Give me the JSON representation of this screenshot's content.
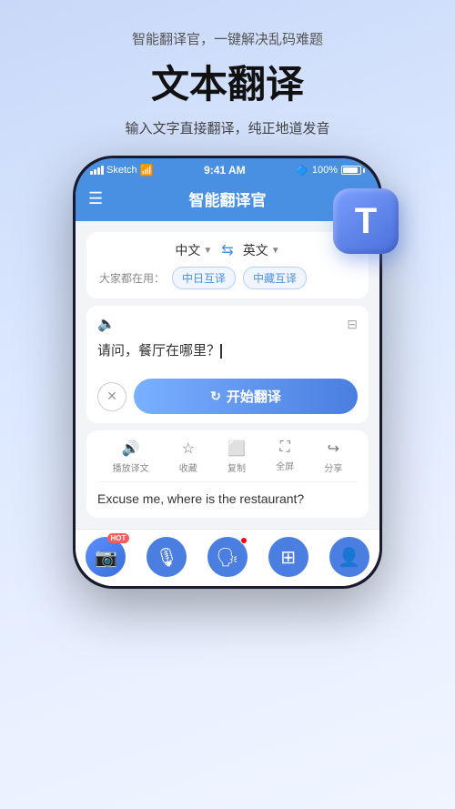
{
  "page": {
    "bg_subtitle": "智能翻译官，一键解决乱码难题",
    "bg_title": "文本翻译",
    "bg_desc": "输入文字直接翻译，纯正地道发音"
  },
  "status_bar": {
    "signal": "Sketch",
    "time": "9:41 AM",
    "battery_pct": "100%"
  },
  "header": {
    "title": "智能翻译官"
  },
  "lang_selector": {
    "source_lang": "中文",
    "source_arrow": "▼",
    "target_lang": "英文",
    "target_arrow": "▼",
    "popular_label": "大家都在用：",
    "tag1": "中日互译",
    "tag2": "中藏互译"
  },
  "input_area": {
    "text": "请问，餐厅在哪里？",
    "clear_icon": "✕",
    "translate_btn": "开始翻译"
  },
  "output_area": {
    "actions": [
      {
        "icon": "🔊",
        "label": "播放译文"
      },
      {
        "icon": "☆",
        "label": "收藏"
      },
      {
        "icon": "⬜",
        "label": "复制"
      },
      {
        "icon": "⛶",
        "label": "全屏"
      },
      {
        "icon": "↪",
        "label": "分享"
      }
    ],
    "text": "Excuse me, where is the restaurant?"
  },
  "bottom_nav": [
    {
      "icon": "📷",
      "label": "",
      "has_hot": true
    },
    {
      "icon": "🎙",
      "label": ""
    },
    {
      "icon": "👤",
      "label": "",
      "has_dot": true
    },
    {
      "icon": "⊞",
      "label": ""
    },
    {
      "icon": "👤",
      "label": ""
    }
  ]
}
